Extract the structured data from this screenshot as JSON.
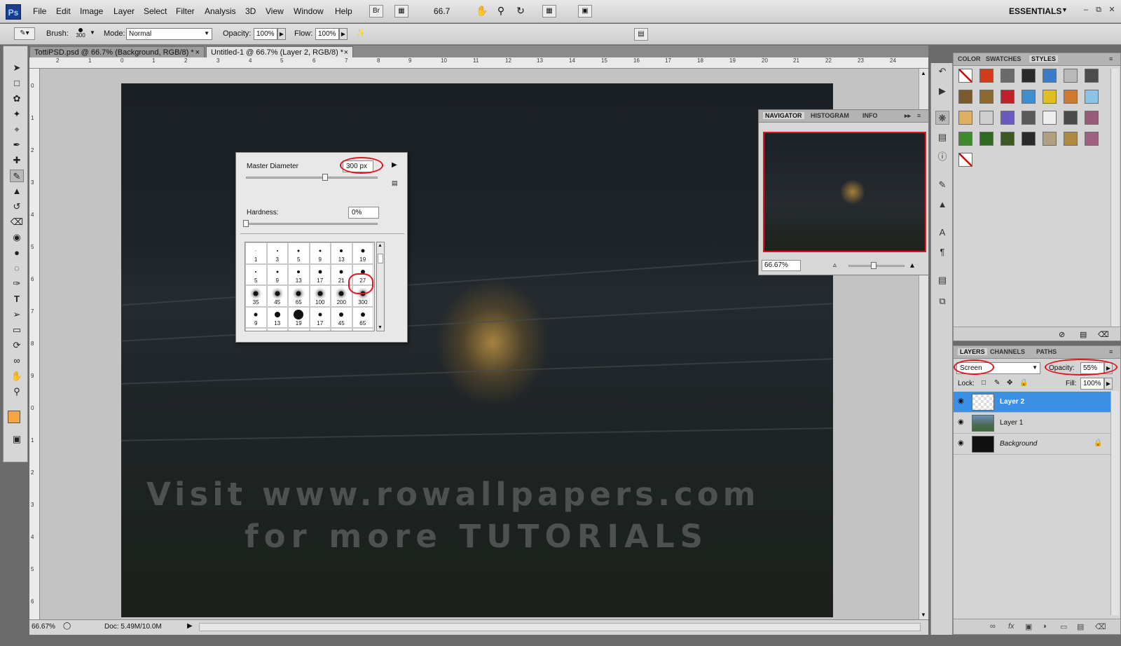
{
  "app": {
    "logo": "Ps"
  },
  "menu": [
    "File",
    "Edit",
    "Image",
    "Layer",
    "Select",
    "Filter",
    "Analysis",
    "3D",
    "View",
    "Window",
    "Help"
  ],
  "appbar": {
    "zoom": "66.7",
    "workspace": "ESSENTIALS",
    "br": "Br"
  },
  "options": {
    "brush_label": "Brush:",
    "brush_size": "300",
    "mode_label": "Mode:",
    "mode_value": "Normal",
    "opacity_label": "Opacity:",
    "opacity_value": "100%",
    "flow_label": "Flow:",
    "flow_value": "100%"
  },
  "tabs": [
    {
      "label": "TottiPSD.psd @ 66.7% (Background, RGB/8) *"
    },
    {
      "label": "Untitled-1 @ 66.7% (Layer 2, RGB/8) *"
    }
  ],
  "ruler_top": [
    "2",
    "1",
    "0",
    "1",
    "2",
    "3",
    "4",
    "5",
    "6",
    "7",
    "8",
    "9",
    "10",
    "11",
    "12",
    "13",
    "14",
    "15",
    "16",
    "17",
    "18",
    "19",
    "20",
    "21",
    "22",
    "23",
    "24"
  ],
  "ruler_left": [
    "0",
    "1",
    "2",
    "3",
    "4",
    "5",
    "6",
    "7",
    "8",
    "9",
    "0",
    "1",
    "2",
    "3",
    "4",
    "5",
    "6"
  ],
  "canvas": {
    "watermark_line1": "Visit www.rowallpapers.com",
    "watermark_line2": "for more TUTORIALS"
  },
  "brush_picker": {
    "master_diameter_label": "Master Diameter",
    "master_diameter_value": "300 px",
    "master_diameter_fraction": 0.6,
    "hardness_label": "Hardness:",
    "hardness_value": "0%",
    "hardness_fraction": 0.0,
    "presets": [
      {
        "n": "1",
        "d": 1
      },
      {
        "n": "3",
        "d": 2
      },
      {
        "n": "5",
        "d": 3
      },
      {
        "n": "9",
        "d": 3
      },
      {
        "n": "13",
        "d": 4
      },
      {
        "n": "19",
        "d": 5
      },
      {
        "n": "5",
        "d": 2
      },
      {
        "n": "9",
        "d": 3
      },
      {
        "n": "13",
        "d": 4
      },
      {
        "n": "17",
        "d": 5
      },
      {
        "n": "21",
        "d": 5
      },
      {
        "n": "27",
        "d": 6
      },
      {
        "n": "35",
        "d": 7
      },
      {
        "n": "45",
        "d": 7
      },
      {
        "n": "65",
        "d": 7
      },
      {
        "n": "100",
        "d": 7
      },
      {
        "n": "200",
        "d": 7
      },
      {
        "n": "300",
        "d": 7
      },
      {
        "n": "9",
        "d": 5
      },
      {
        "n": "13",
        "d": 8
      },
      {
        "n": "19",
        "d": 14
      },
      {
        "n": "17",
        "d": 5
      },
      {
        "n": "45",
        "d": 6
      },
      {
        "n": "65",
        "d": 6
      },
      {
        "n": "",
        "d": 6
      },
      {
        "n": "",
        "d": 6
      },
      {
        "n": "",
        "d": 6
      },
      {
        "n": "",
        "d": 6
      },
      {
        "n": "",
        "d": 6
      },
      {
        "n": "",
        "d": 6
      }
    ]
  },
  "navigator": {
    "tabs": [
      "NAVIGATOR",
      "HISTOGRAM",
      "INFO"
    ],
    "zoom": "66.67%"
  },
  "styles_panel": {
    "tabs": [
      "COLOR",
      "SWATCHES",
      "STYLES"
    ],
    "swatch_colors": [
      "#ffffff",
      "#d13b1b",
      "#6a6a6a",
      "#2a2a2a",
      "#3a7cc7",
      "#b9b9b9",
      "#4d4d4d",
      "#7a5a2c",
      "#8a6a30",
      "#c0202a",
      "#3d8fd0",
      "#e0c020",
      "#d07a30",
      "#8cc4e8",
      "#e0b060",
      "#cfcfcf",
      "#6a5abf",
      "#5a5a5a",
      "#eeeeee",
      "#4a4a4a",
      "#9a5a7a",
      "#3f8a2a",
      "#2d6b1f",
      "#3b5a20",
      "#2a2a2a",
      "#b0a080",
      "#b08a40",
      "#a06080",
      "#ffffff"
    ]
  },
  "layers": {
    "tabs": [
      "LAYERS",
      "CHANNELS",
      "PATHS"
    ],
    "blend_mode": "Screen",
    "opacity_label": "Opacity:",
    "opacity_value": "55%",
    "lock_label": "Lock:",
    "fill_label": "Fill:",
    "fill_value": "100%",
    "items": [
      {
        "name": "Layer 2",
        "selected": true
      },
      {
        "name": "Layer 1",
        "selected": false
      },
      {
        "name": "Background",
        "selected": false
      }
    ]
  },
  "status": {
    "zoom": "66.67%",
    "doc": "Doc: 5.49M/10.0M"
  }
}
